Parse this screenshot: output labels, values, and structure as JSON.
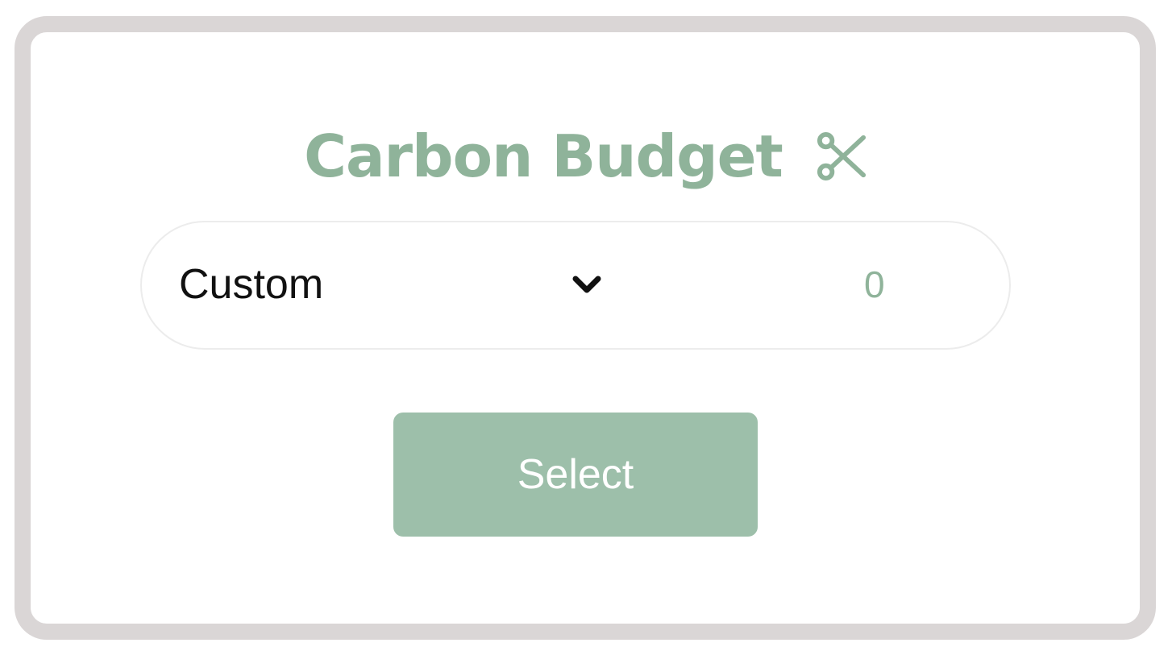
{
  "card": {
    "title": "Carbon Budget",
    "title_icon": "scissors-icon"
  },
  "selector": {
    "label": "Custom",
    "dropdown_icon": "chevron-down-icon",
    "value": "0"
  },
  "actions": {
    "select_label": "Select"
  },
  "colors": {
    "accent": "#8fb39a",
    "button": "#9dbfaa",
    "frame": "#dad6d6",
    "text": "#111111"
  }
}
